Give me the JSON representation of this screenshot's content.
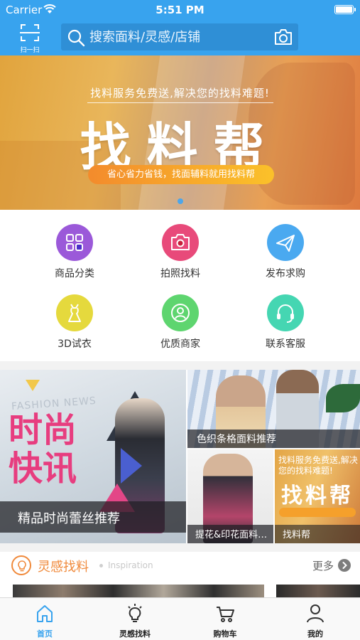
{
  "status_bar": {
    "carrier": "Carrier",
    "time": "5:51 PM"
  },
  "nav": {
    "scan_label": "扫一扫",
    "search_placeholder": "搜索面料/灵感/店铺"
  },
  "banner": {
    "tagline": "找料服务免费送,解决您的找料难题!",
    "title": "找料帮",
    "pill_text": "省心省力省钱，找面辅料就用找料帮",
    "page_count": 1,
    "active_page": 1
  },
  "quick_menu": [
    {
      "label": "商品分类",
      "icon": "grid-icon",
      "color": "#9b59d9"
    },
    {
      "label": "拍照找料",
      "icon": "camera-icon",
      "color": "#e84a7a"
    },
    {
      "label": "发布求购",
      "icon": "paper-plane-icon",
      "color": "#4aa9f0"
    },
    {
      "label": "3D试衣",
      "icon": "dress-icon",
      "color": "#e5d93d"
    },
    {
      "label": "优质商家",
      "icon": "merchant-icon",
      "color": "#5ed56f"
    },
    {
      "label": "联系客服",
      "icon": "headset-icon",
      "color": "#45d6b2"
    }
  ],
  "features": {
    "main": {
      "overlay": "精品时尚蕾丝推荐",
      "image_caption": "FASHION NEWS",
      "image_title_line1": "时尚",
      "image_title_line2": "快讯"
    },
    "top_right": {
      "overlay": "色织条格面料推荐"
    },
    "bottom_left": {
      "overlay": "提花&印花面料推荐"
    },
    "bottom_right": {
      "overlay": "找料帮",
      "image_tagline": "找料服务免费送,解决您的找料难题!",
      "image_title": "找料帮"
    }
  },
  "inspiration": {
    "title": "灵感找料",
    "subtitle": "Inspiration",
    "more": "更多"
  },
  "tabs": [
    {
      "label": "首页",
      "icon": "home-icon",
      "active": true
    },
    {
      "label": "灵感找料",
      "icon": "lightbulb-icon",
      "active": false
    },
    {
      "label": "购物车",
      "icon": "cart-icon",
      "active": false
    },
    {
      "label": "我的",
      "icon": "profile-icon",
      "active": false
    }
  ],
  "colors": {
    "brand_blue": "#38a3ee",
    "accent_orange": "#f08a3c",
    "accent_pink": "#e73d7f"
  }
}
